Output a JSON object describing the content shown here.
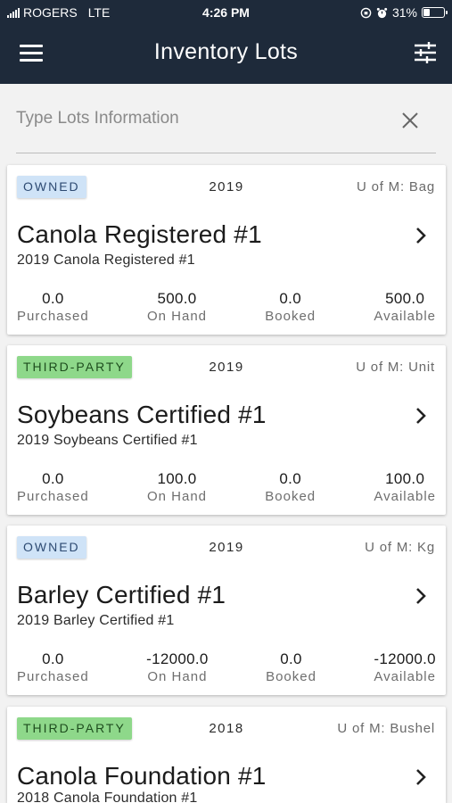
{
  "status_bar": {
    "carrier": "ROGERS",
    "network": "LTE",
    "time": "4:26 PM",
    "battery": "31%",
    "battery_level": 0.31
  },
  "header": {
    "title": "Inventory Lots",
    "menu_icon": "hamburger-menu-icon",
    "filter_icon": "sliders-icon"
  },
  "search": {
    "placeholder": "Type Lots Information",
    "value": ""
  },
  "colors": {
    "header_bg": "#1e2a3a",
    "owned_badge": "#cfe3f7",
    "third_party_badge": "#8ed88a"
  },
  "lots": [
    {
      "badge": "OWNED",
      "year": "2019",
      "uom": "U of M: Bag",
      "name": "Canola Registered #1",
      "description": "2019 Canola Registered #1",
      "purchased": "0.0",
      "on_hand": "500.0",
      "booked": "0.0",
      "available": "500.0"
    },
    {
      "badge": "THIRD-PARTY",
      "year": "2019",
      "uom": "U of M: Unit",
      "name": "Soybeans Certified #1",
      "description": "2019 Soybeans Certified #1",
      "purchased": "0.0",
      "on_hand": "100.0",
      "booked": "0.0",
      "available": "100.0"
    },
    {
      "badge": "OWNED",
      "year": "2019",
      "uom": "U of M: Kg",
      "name": "Barley Certified #1",
      "description": "2019 Barley Certified #1",
      "purchased": "0.0",
      "on_hand": "-12000.0",
      "booked": "0.0",
      "available": "-12000.0"
    },
    {
      "badge": "THIRD-PARTY",
      "year": "2018",
      "uom": "U of M: Bushel",
      "name": "Canola Foundation #1",
      "description": "2018 Canola Foundation #1"
    }
  ],
  "stat_labels": {
    "purchased": "Purchased",
    "on_hand": "On Hand",
    "booked": "Booked",
    "available": "Available"
  }
}
